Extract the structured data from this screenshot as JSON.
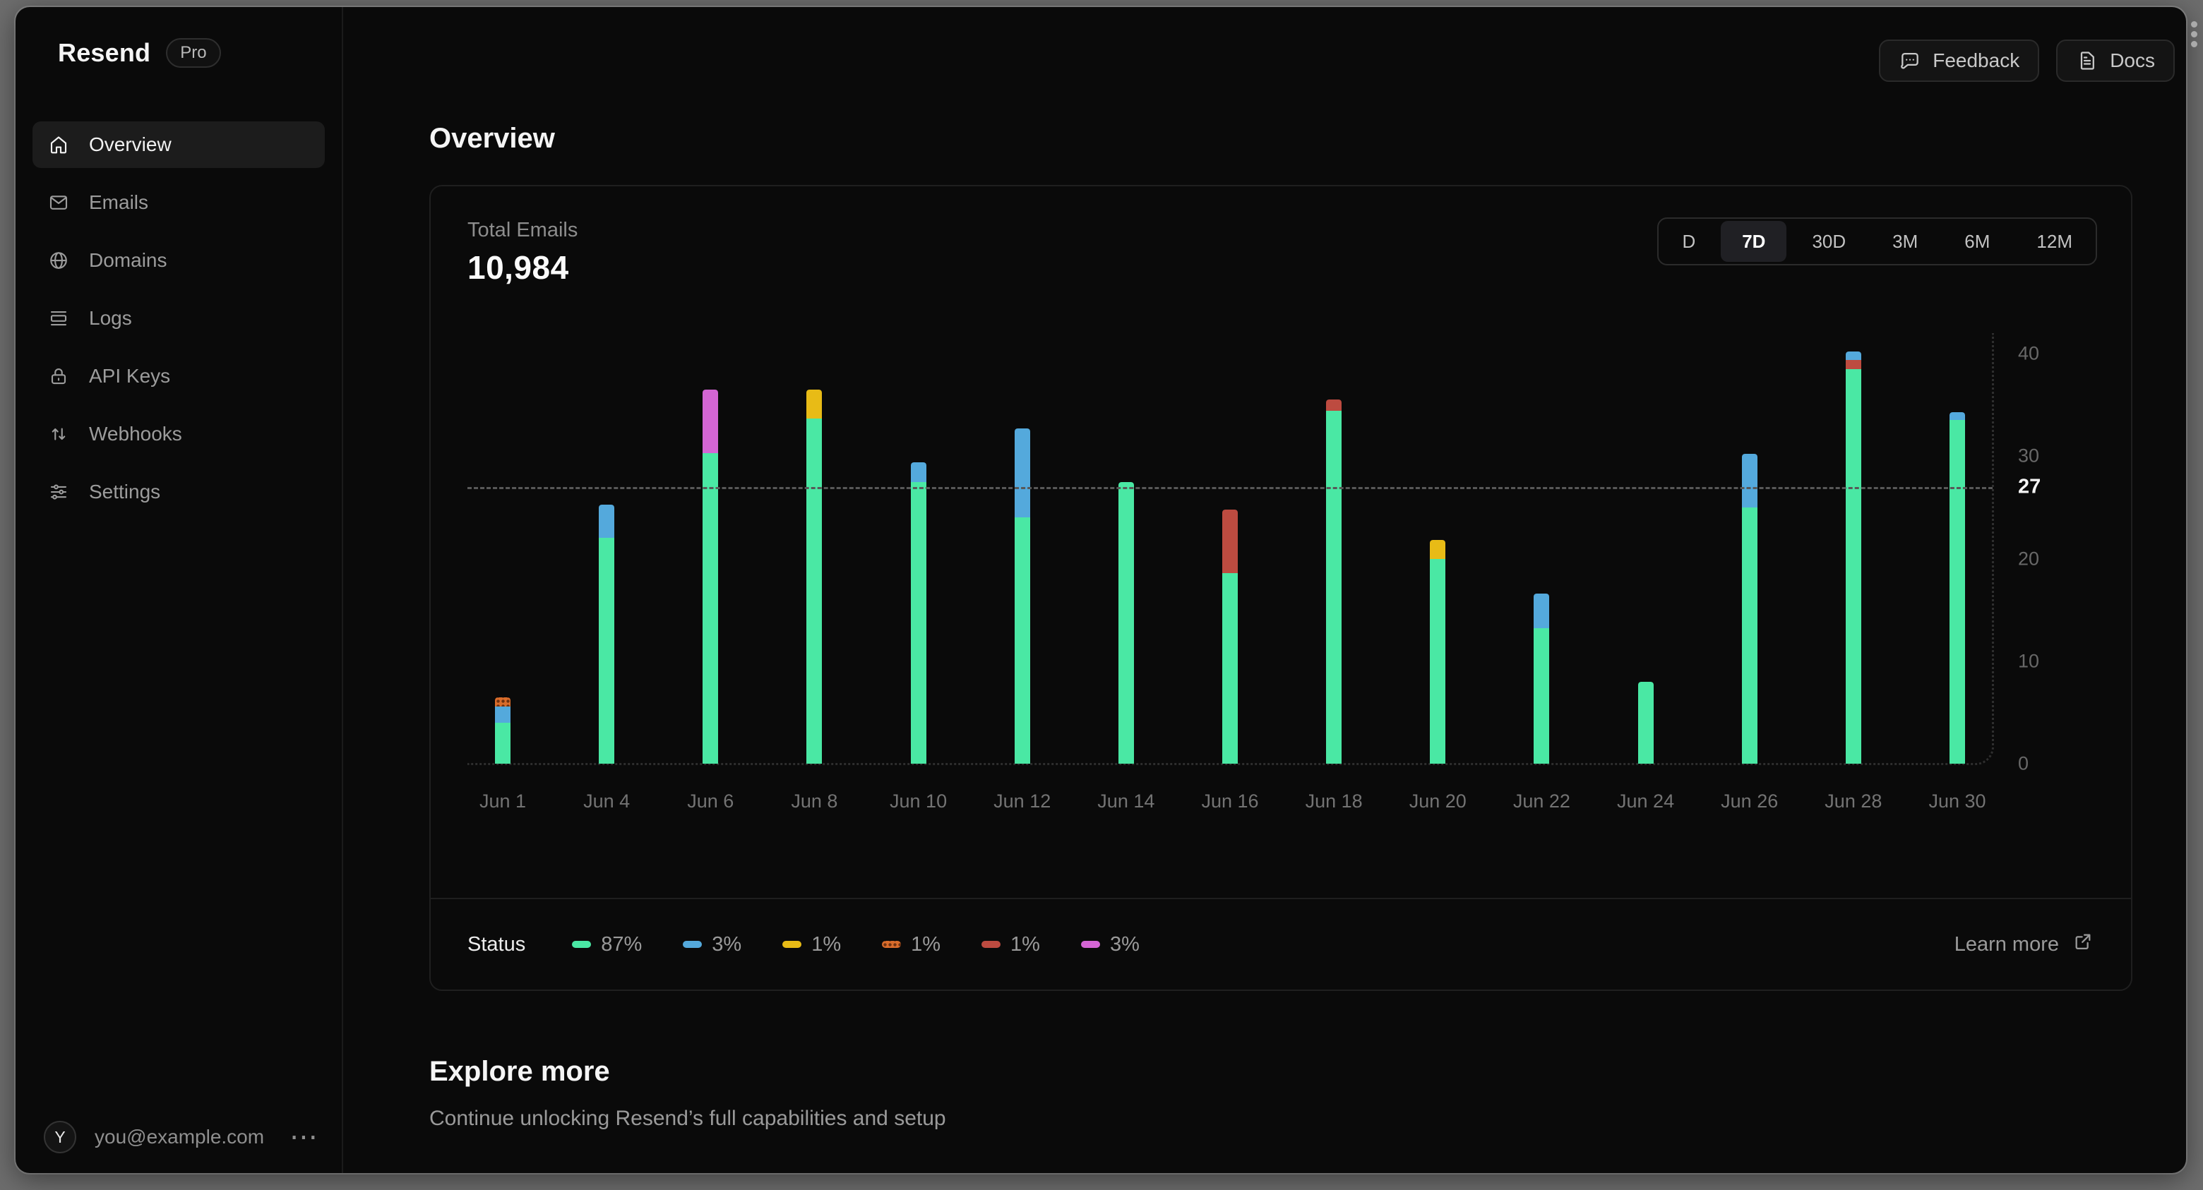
{
  "brand": {
    "name": "Resend",
    "badge": "Pro"
  },
  "topbar": {
    "buttons": [
      {
        "label": "Feedback",
        "icon": "chat"
      },
      {
        "label": "Docs",
        "icon": "doc"
      }
    ]
  },
  "sidebar": {
    "items": [
      {
        "label": "Overview",
        "icon": "home",
        "active": true
      },
      {
        "label": "Emails",
        "icon": "mail",
        "active": false
      },
      {
        "label": "Domains",
        "icon": "globe",
        "active": false
      },
      {
        "label": "Logs",
        "icon": "logs",
        "active": false
      },
      {
        "label": "API Keys",
        "icon": "lock",
        "active": false
      },
      {
        "label": "Webhooks",
        "icon": "webhooks",
        "active": false
      },
      {
        "label": "Settings",
        "icon": "settings",
        "active": false
      }
    ],
    "user": {
      "initial": "Y",
      "email": "you@example.com",
      "menu_icon": "ellipsis"
    }
  },
  "page": {
    "title": "Overview"
  },
  "card": {
    "metric_label": "Total Emails",
    "metric_value": "10,984",
    "ranges": [
      "D",
      "7D",
      "30D",
      "3M",
      "6M",
      "12M"
    ],
    "active_range": "7D",
    "legend_title": "Status",
    "legend": [
      {
        "pct": "87%",
        "color": "#4ae8a4"
      },
      {
        "pct": "3%",
        "color": "#54a9dc"
      },
      {
        "pct": "1%",
        "color": "#e8bb16"
      },
      {
        "pct": "1%",
        "color": "#d96c2b",
        "pattern": "dots"
      },
      {
        "pct": "1%",
        "color": "#bd4b40"
      },
      {
        "pct": "3%",
        "color": "#d465d4"
      }
    ],
    "learn_more": "Learn more"
  },
  "explore": {
    "title": "Explore more",
    "subtitle": "Continue unlocking Resend’s full capabilities and setup"
  },
  "chart_data": {
    "type": "bar",
    "stacked": true,
    "title": "Total Emails",
    "categories": [
      "Jun 1",
      "Jun 4",
      "Jun 6",
      "Jun 8",
      "Jun 10",
      "Jun 12",
      "Jun 14",
      "Jun 16",
      "Jun 18",
      "Jun 20",
      "Jun 22",
      "Jun 24",
      "Jun 26",
      "Jun 28",
      "Jun 30"
    ],
    "series": [
      {
        "name": "green",
        "color": "#4ae8a4",
        "values": [
          4,
          22,
          30.3,
          33.7,
          27.5,
          24,
          27.5,
          18.6,
          34.4,
          20,
          13.2,
          8,
          25,
          38.5,
          33.5
        ]
      },
      {
        "name": "red",
        "color": "#bd4b40",
        "values": [
          0,
          0,
          0,
          0,
          0,
          0,
          0,
          6.2,
          1.1,
          0,
          0,
          0,
          0,
          0.9,
          0
        ]
      },
      {
        "name": "blue",
        "color": "#54a9dc",
        "values": [
          1.6,
          3.3,
          0,
          0,
          1.9,
          8.7,
          0,
          0,
          0,
          0,
          3.4,
          0,
          5.2,
          0.8,
          0.8
        ]
      },
      {
        "name": "yellow",
        "color": "#e8bb16",
        "values": [
          0,
          0,
          0,
          2.8,
          0,
          0,
          0,
          0,
          0,
          1.8,
          0,
          0,
          0,
          0,
          0
        ]
      },
      {
        "name": "magenta",
        "color": "#d465d4",
        "values": [
          0,
          0,
          6.2,
          0,
          0,
          0,
          0,
          0,
          0,
          0,
          0,
          0,
          0,
          0,
          0
        ]
      },
      {
        "name": "orange",
        "color": "#d96c2b",
        "pattern": "dots",
        "values": [
          0.9,
          0,
          0,
          0,
          0,
          0,
          0,
          0,
          0,
          0,
          0,
          0,
          0,
          0,
          0
        ]
      }
    ],
    "stack_order": "bottom-to-top",
    "ylim": [
      0,
      40
    ],
    "yticks": [
      0,
      10,
      20,
      30,
      40
    ],
    "threshold": {
      "value": 27,
      "label": "27"
    },
    "grid": false,
    "legend_position": "bottom"
  }
}
